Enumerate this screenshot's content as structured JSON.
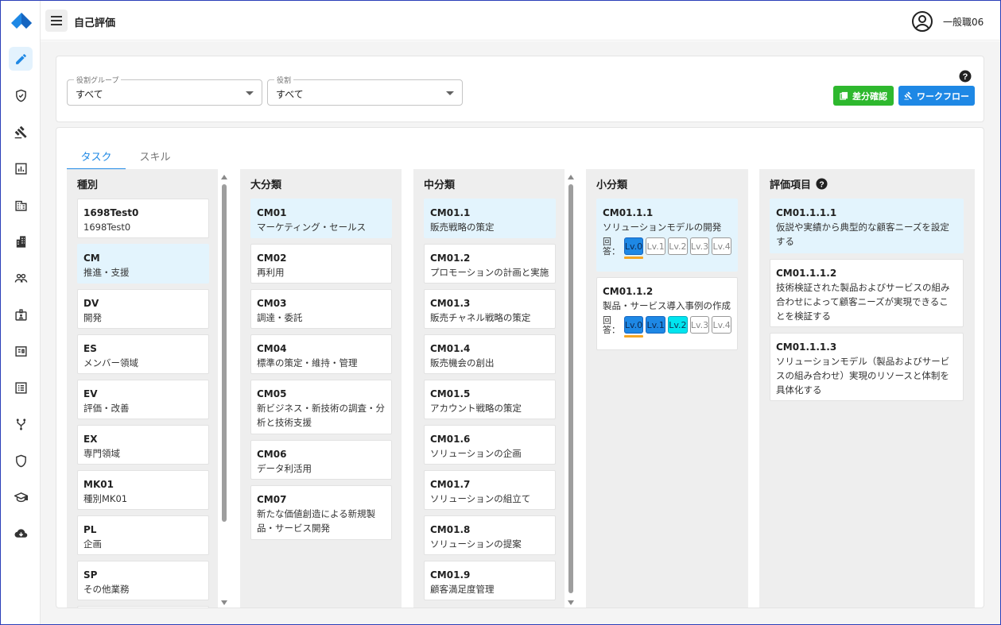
{
  "header": {
    "title": "自己評価",
    "user_name": "一般職06"
  },
  "colors": {
    "accent": "#1e88e5",
    "success": "#2eb82e",
    "selected_bg": "#e3f4fd",
    "target_level": "#00e5ef",
    "current_marker": "#f5a623"
  },
  "sidebar": {
    "items": [
      {
        "icon": "pencil-icon",
        "active": true
      },
      {
        "icon": "shield-check-icon"
      },
      {
        "icon": "gavel-icon"
      },
      {
        "icon": "bar-chart-icon"
      },
      {
        "icon": "company-icon"
      },
      {
        "icon": "building-icon"
      },
      {
        "icon": "people-icon"
      },
      {
        "icon": "badge-icon"
      },
      {
        "icon": "id-card-icon"
      },
      {
        "icon": "list-alt-icon"
      },
      {
        "icon": "fork-icon"
      },
      {
        "icon": "shield-icon"
      },
      {
        "icon": "graduation-cap-icon"
      },
      {
        "icon": "cloud-download-icon"
      }
    ]
  },
  "filters": {
    "role_group": {
      "label": "役割グループ",
      "value": "すべて"
    },
    "role": {
      "label": "役割",
      "value": "すべて"
    }
  },
  "buttons": {
    "diff": "差分確認",
    "workflow": "ワークフロー"
  },
  "tabs": [
    {
      "label": "タスク",
      "active": true
    },
    {
      "label": "スキル",
      "active": false
    }
  ],
  "columns": {
    "type": {
      "title": "種別",
      "items": [
        {
          "code": "1698Test0",
          "name": "1698Test0"
        },
        {
          "code": "CM",
          "name": "推進・支援",
          "selected": true
        },
        {
          "code": "DV",
          "name": "開発"
        },
        {
          "code": "ES",
          "name": "メンバー領域"
        },
        {
          "code": "EV",
          "name": "評価・改善"
        },
        {
          "code": "EX",
          "name": "専門領域"
        },
        {
          "code": "MK01",
          "name": "種別MK01"
        },
        {
          "code": "PL",
          "name": "企画"
        },
        {
          "code": "SP",
          "name": "その他業務"
        }
      ]
    },
    "major": {
      "title": "大分類",
      "items": [
        {
          "code": "CM01",
          "name": "マーケティング・セールス",
          "selected": true
        },
        {
          "code": "CM02",
          "name": "再利用"
        },
        {
          "code": "CM03",
          "name": "調達・委託"
        },
        {
          "code": "CM04",
          "name": "標準の策定・維持・管理"
        },
        {
          "code": "CM05",
          "name": "新ビジネス・新技術の調査・分析と技術支援"
        },
        {
          "code": "CM06",
          "name": "データ利活用"
        },
        {
          "code": "CM07",
          "name": "新たな価値創造による新規製品・サービス開発"
        }
      ]
    },
    "middle": {
      "title": "中分類",
      "items": [
        {
          "code": "CM01.1",
          "name": "販売戦略の策定",
          "selected": true
        },
        {
          "code": "CM01.2",
          "name": "プロモーションの計画と実施"
        },
        {
          "code": "CM01.3",
          "name": "販売チャネル戦略の策定"
        },
        {
          "code": "CM01.4",
          "name": "販売機会の創出"
        },
        {
          "code": "CM01.5",
          "name": "アカウント戦略の策定"
        },
        {
          "code": "CM01.6",
          "name": "ソリューションの企画"
        },
        {
          "code": "CM01.7",
          "name": "ソリューションの組立て"
        },
        {
          "code": "CM01.8",
          "name": "ソリューションの提案"
        },
        {
          "code": "CM01.9",
          "name": "顧客満足度管理"
        }
      ]
    },
    "minor": {
      "title": "小分類",
      "answer_label": "回答：",
      "items": [
        {
          "code": "CM01.1.1",
          "name": "ソリューションモデルの開発",
          "selected": true,
          "levels": [
            "Lv.0",
            "Lv.1",
            "Lv.2",
            "Lv.3",
            "Lv.4"
          ],
          "answered_level": 0,
          "target_level": null
        },
        {
          "code": "CM01.1.2",
          "name": "製品・サービス導入事例の作成",
          "levels": [
            "Lv.0",
            "Lv.1",
            "Lv.2",
            "Lv.3",
            "Lv.4"
          ],
          "answered_level": 1,
          "target_level": 2
        }
      ]
    },
    "eval": {
      "title": "評価項目",
      "items": [
        {
          "code": "CM01.1.1.1",
          "name": "仮説や実績から典型的な顧客ニーズを設定する",
          "selected": true
        },
        {
          "code": "CM01.1.1.2",
          "name": "技術検証された製品およびサービスの組み合わせによって顧客ニーズが実現できることを検証する"
        },
        {
          "code": "CM01.1.1.3",
          "name": "ソリューションモデル（製品およびサービスの組み合わせ）実現のリソースと体制を具体化する"
        }
      ]
    }
  }
}
